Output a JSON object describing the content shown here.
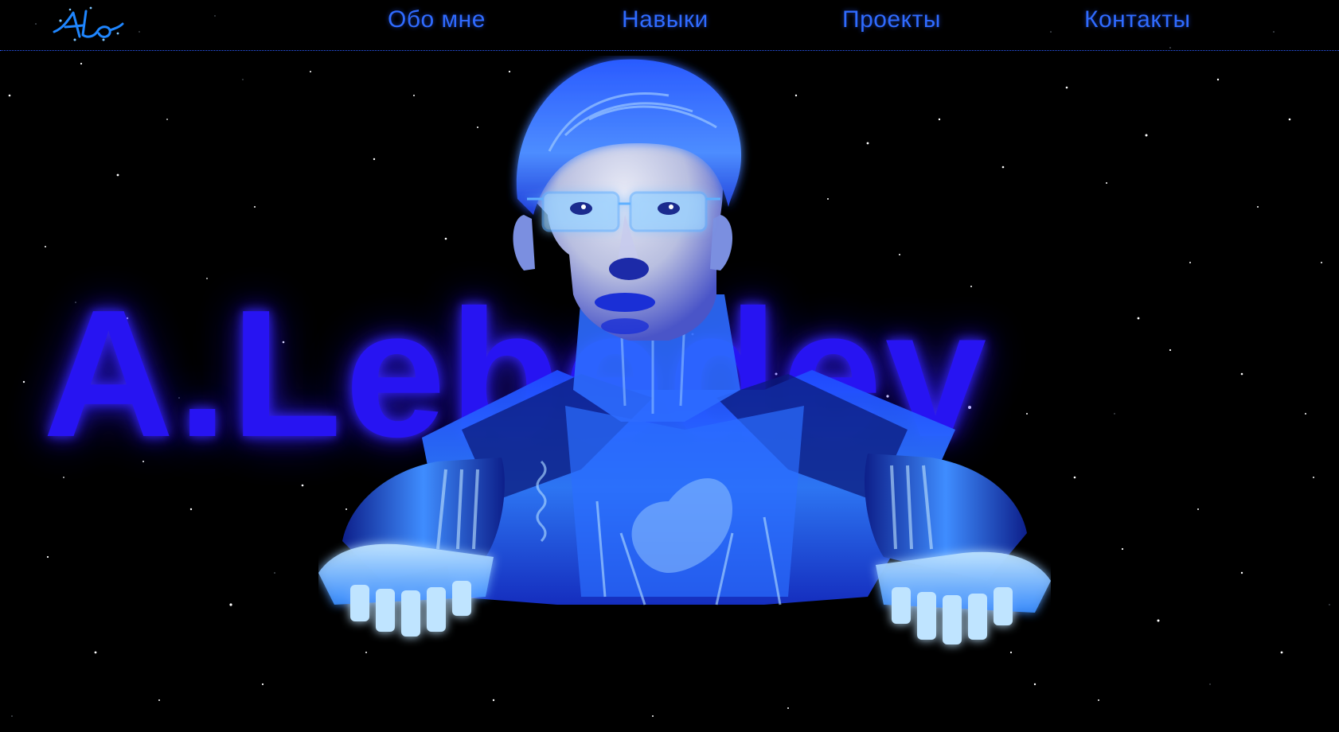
{
  "header": {
    "logo_text": "AL",
    "nav": [
      {
        "label": "Обо мне"
      },
      {
        "label": "Навыки"
      },
      {
        "label": "Проекты"
      },
      {
        "label": "Контакты"
      }
    ]
  },
  "hero": {
    "title": "A.Lebedev"
  },
  "colors": {
    "background": "#000000",
    "nav_link": "#2f6bff",
    "title_glow": "#2a16ff",
    "figure_blue": "#3b7bff"
  },
  "icons": {
    "logo": "logo-icon",
    "figure": "robot-figure-illustration"
  }
}
